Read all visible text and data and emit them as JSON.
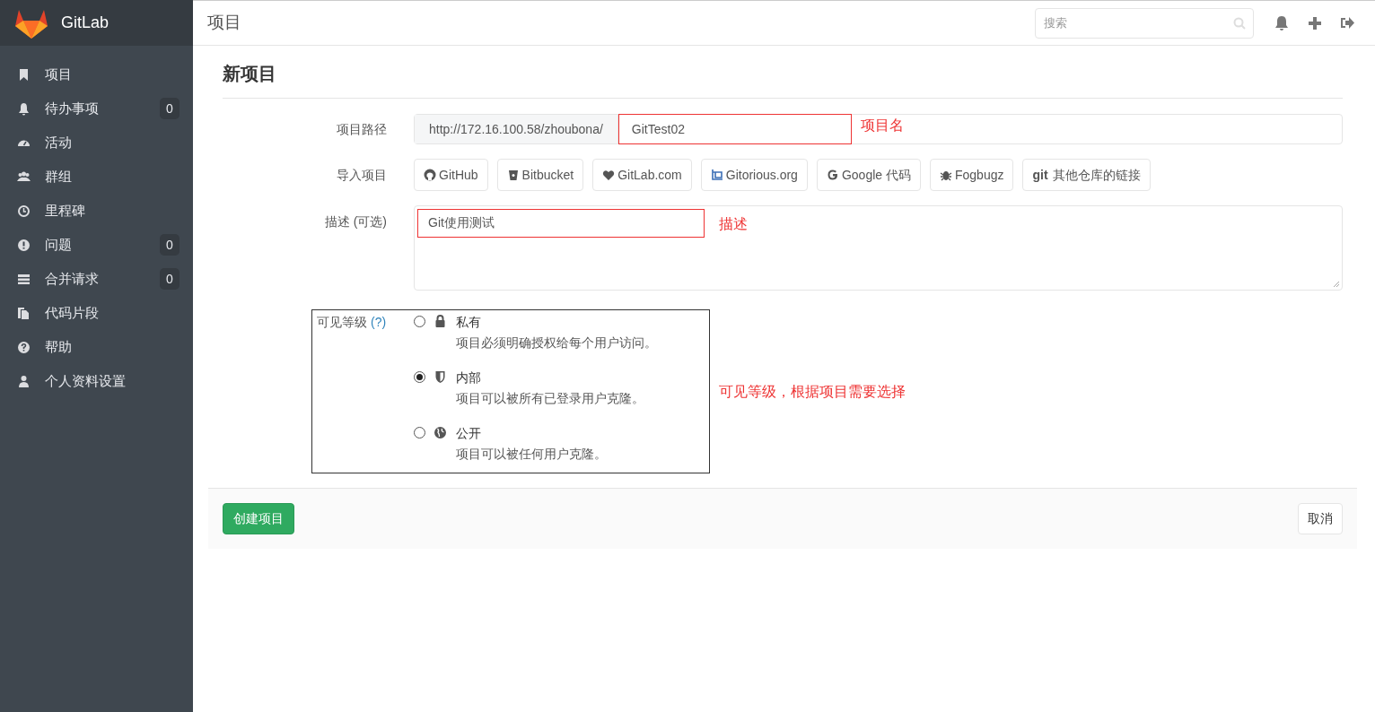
{
  "brand": {
    "name": "GitLab"
  },
  "sidebar": {
    "items": [
      {
        "kind": "bookmark",
        "label": "项目"
      },
      {
        "kind": "bell",
        "label": "待办事项",
        "count": "0"
      },
      {
        "kind": "gauge",
        "label": "活动"
      },
      {
        "kind": "users",
        "label": "群组"
      },
      {
        "kind": "clock",
        "label": "里程碑"
      },
      {
        "kind": "alert",
        "label": "问题",
        "count": "0"
      },
      {
        "kind": "list",
        "label": "合并请求",
        "count": "0"
      },
      {
        "kind": "copy",
        "label": "代码片段"
      },
      {
        "kind": "help",
        "label": "帮助"
      },
      {
        "kind": "user",
        "label": "个人资料设置"
      }
    ]
  },
  "header": {
    "title": "项目",
    "search": {
      "placeholder": "搜索"
    }
  },
  "page": {
    "heading": "新项目",
    "path": {
      "label": "项目路径",
      "prefix": "http://172.16.100.58/zhoubona/",
      "value": "GitTest02",
      "annotation": "项目名"
    },
    "import": {
      "label": "导入项目",
      "sources": [
        {
          "kind": "github",
          "label": "GitHub"
        },
        {
          "kind": "bitbucket",
          "label": "Bitbucket"
        },
        {
          "kind": "heart",
          "label": "GitLab.com"
        },
        {
          "kind": "gitorious",
          "label": "Gitorious.org"
        },
        {
          "kind": "google",
          "label": "Google 代码"
        },
        {
          "kind": "bug",
          "label": "Fogbugz"
        },
        {
          "kind": "git",
          "label": "其他仓库的链接",
          "prefix": "git"
        }
      ]
    },
    "description": {
      "label": "描述 (可选)",
      "value": "Git使用测试",
      "annotation": "描述"
    },
    "visibility": {
      "label": "可见等级",
      "help": "(?)",
      "annotation": "可见等级，根据项目需要选择",
      "options": [
        {
          "kind": "lock",
          "title": "私有",
          "description": "项目必须明确授权给每个用户访问。",
          "selected": false
        },
        {
          "kind": "shield",
          "title": "内部",
          "description": "项目可以被所有已登录用户克隆。",
          "selected": true
        },
        {
          "kind": "globe",
          "title": "公开",
          "description": "项目可以被任何用户克隆。",
          "selected": false
        }
      ]
    },
    "actions": {
      "create": "创建项目",
      "cancel": "取消"
    }
  }
}
